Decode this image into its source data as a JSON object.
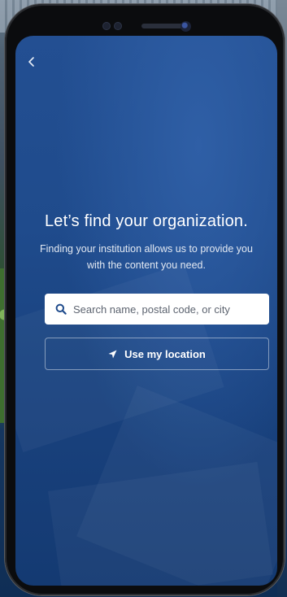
{
  "screen": {
    "back_icon": "chevron-left-icon",
    "heading": "Let’s find your organization.",
    "subtitle": "Finding your institution allows us to provide you with the content you need."
  },
  "search": {
    "icon": "search-icon",
    "placeholder": "Search name, postal code, or city",
    "value": ""
  },
  "location_button": {
    "icon": "location-arrow-icon",
    "label": "Use my location"
  },
  "colors": {
    "screen_bg": "#1f4b8c",
    "accent_icon": "#1f4b8c",
    "text": "#ffffff"
  }
}
